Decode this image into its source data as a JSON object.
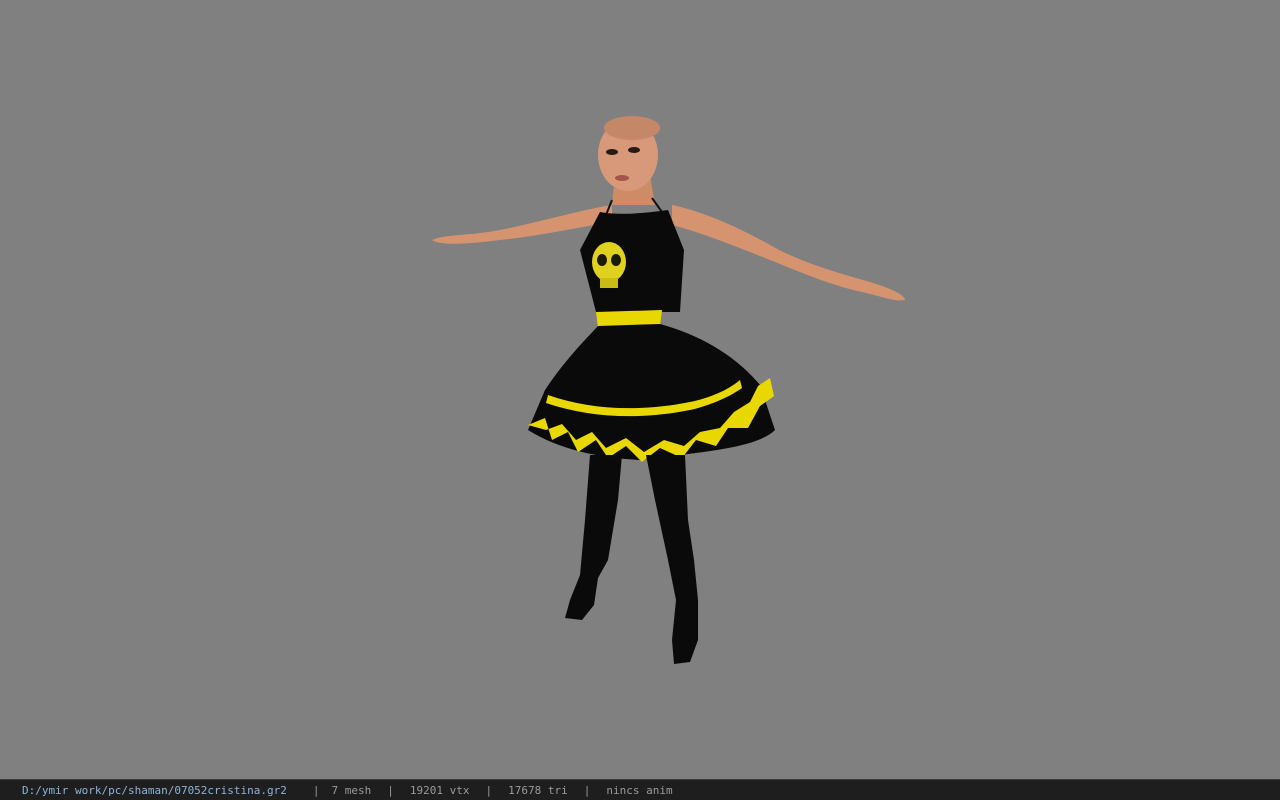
{
  "viewport": {
    "background": "#808080",
    "model": "character-model"
  },
  "status": {
    "path": "D:/ymir work/pc/shaman/07052cristina.gr2",
    "separator": "|",
    "mesh": "7 mesh",
    "vtx": "19201 vtx",
    "tri": "17678 tri",
    "anim": "nincs anim"
  },
  "colors": {
    "skin": "#d89872",
    "dress": "#0a0a0a",
    "accent": "#e8d800",
    "statusbar": "#1e1e1e"
  }
}
